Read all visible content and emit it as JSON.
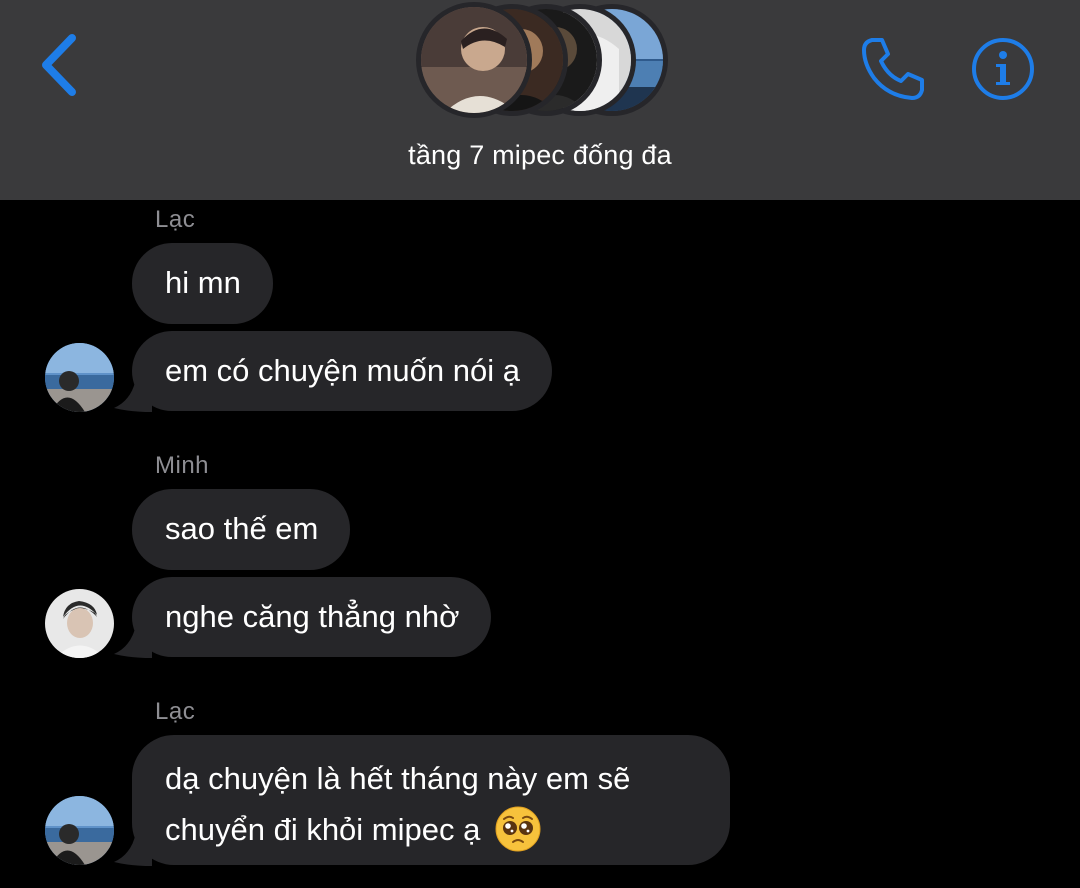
{
  "header": {
    "back_icon": "chevron-left-icon",
    "title": "tầng 7 mipec đống đa",
    "call_icon": "phone-icon",
    "info_icon": "info-icon",
    "accent_color": "#1e7de8"
  },
  "messages": [
    {
      "sender": "Lạc",
      "bubbles": [
        "hi mn",
        "em có chuyện muốn nói ạ"
      ]
    },
    {
      "sender": "Minh",
      "bubbles": [
        "sao thế em",
        "nghe căng thẳng nhờ"
      ]
    },
    {
      "sender": "Lạc",
      "bubbles": [
        {
          "line1": "dạ chuyện là hết tháng này em sẽ",
          "line2": "chuyển đi khỏi mipec ạ",
          "emoji": "pleading-face-emoji"
        }
      ]
    }
  ]
}
